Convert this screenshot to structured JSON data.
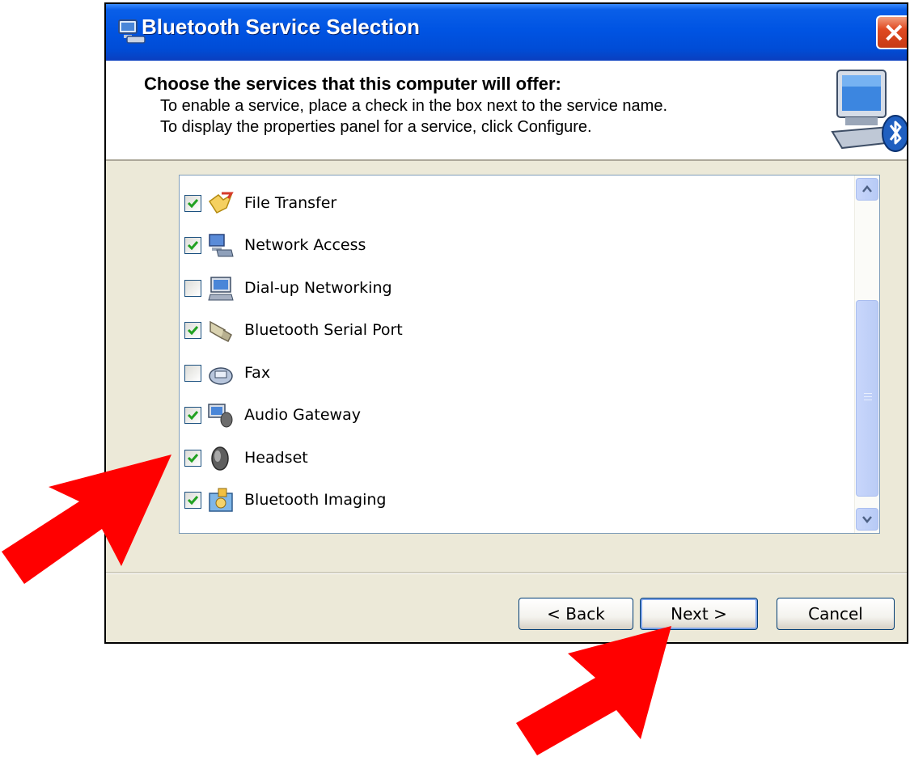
{
  "window": {
    "title": "Bluetooth Service Selection",
    "close_label": "×"
  },
  "header": {
    "heading": "Choose the services that this computer will offer:",
    "line1": "To enable a service, place a check in the box next to the service name.",
    "line2": "To display the properties panel for a service, click Configure."
  },
  "services": [
    {
      "label": "File Transfer",
      "checked": true,
      "icon": "file-transfer-icon"
    },
    {
      "label": "Network Access",
      "checked": true,
      "icon": "network-access-icon"
    },
    {
      "label": "Dial-up Networking",
      "checked": false,
      "icon": "dialup-networking-icon"
    },
    {
      "label": "Bluetooth Serial Port",
      "checked": true,
      "icon": "serial-port-icon"
    },
    {
      "label": "Fax",
      "checked": false,
      "icon": "fax-icon"
    },
    {
      "label": "Audio Gateway",
      "checked": true,
      "icon": "audio-gateway-icon"
    },
    {
      "label": "Headset",
      "checked": true,
      "icon": "headset-icon"
    },
    {
      "label": "Bluetooth Imaging",
      "checked": true,
      "icon": "bluetooth-imaging-icon"
    }
  ],
  "buttons": {
    "back": "< Back",
    "next": "Next >",
    "cancel": "Cancel"
  },
  "colors": {
    "titlebar": "#0054E3",
    "dialog_bg": "#ECE9D8",
    "check": "#21A121",
    "annotation_arrow": "#FF0000"
  }
}
